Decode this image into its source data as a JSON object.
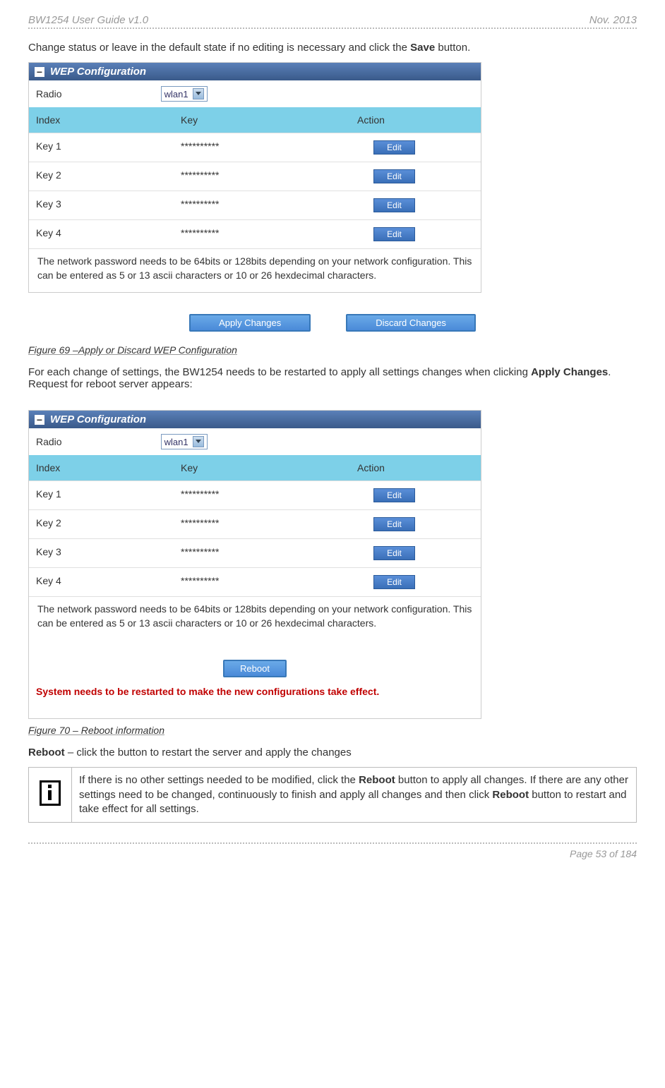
{
  "header": {
    "left": "BW1254 User Guide v1.0",
    "right": "Nov.  2013"
  },
  "para1_pre": "Change status or leave in the default state if no editing is necessary and click the ",
  "para1_bold": "Save",
  "para1_post": " button.",
  "panel": {
    "title": "WEP Configuration",
    "radio_label": "Radio",
    "radio_value": "wlan1",
    "headers": {
      "index": "Index",
      "key": "Key",
      "action": "Action"
    },
    "rows": [
      {
        "label": "Key 1",
        "value": "**********",
        "btn": "Edit"
      },
      {
        "label": "Key 2",
        "value": "**********",
        "btn": "Edit"
      },
      {
        "label": "Key 3",
        "value": "**********",
        "btn": "Edit"
      },
      {
        "label": "Key 4",
        "value": "**********",
        "btn": "Edit"
      }
    ],
    "note": "The network password needs to be 64bits or 128bits depending on your network configuration. This can be entered as 5 or 13 ascii characters or 10 or 26 hexdecimal characters."
  },
  "buttons": {
    "apply": "Apply Changes",
    "discard": "Discard Changes",
    "reboot": "Reboot"
  },
  "fig69": "Figure 69 –Apply or Discard WEP Configuration",
  "para2_a": "For each change of settings, the BW1254 needs to be restarted to apply all settings changes when clicking ",
  "para2_b": "Apply Changes",
  "para2_c": ". Request for reboot server appears:",
  "red_msg": "System needs to be restarted to make the new configurations take effect.",
  "fig70": "Figure 70 – Reboot information",
  "reboot_line_a": "Reboot",
  "reboot_line_b": " – click the button to restart the server and apply the changes",
  "info_a": "If there is no other settings needed to be modified, click the ",
  "info_b": "Reboot",
  "info_c": " button to apply all changes. If there are any other settings need to be changed, continuously to finish and apply all changes and then click ",
  "info_d": "Reboot",
  "info_e": " button to restart and take effect for all settings.",
  "footer": "Page 53 of 184"
}
